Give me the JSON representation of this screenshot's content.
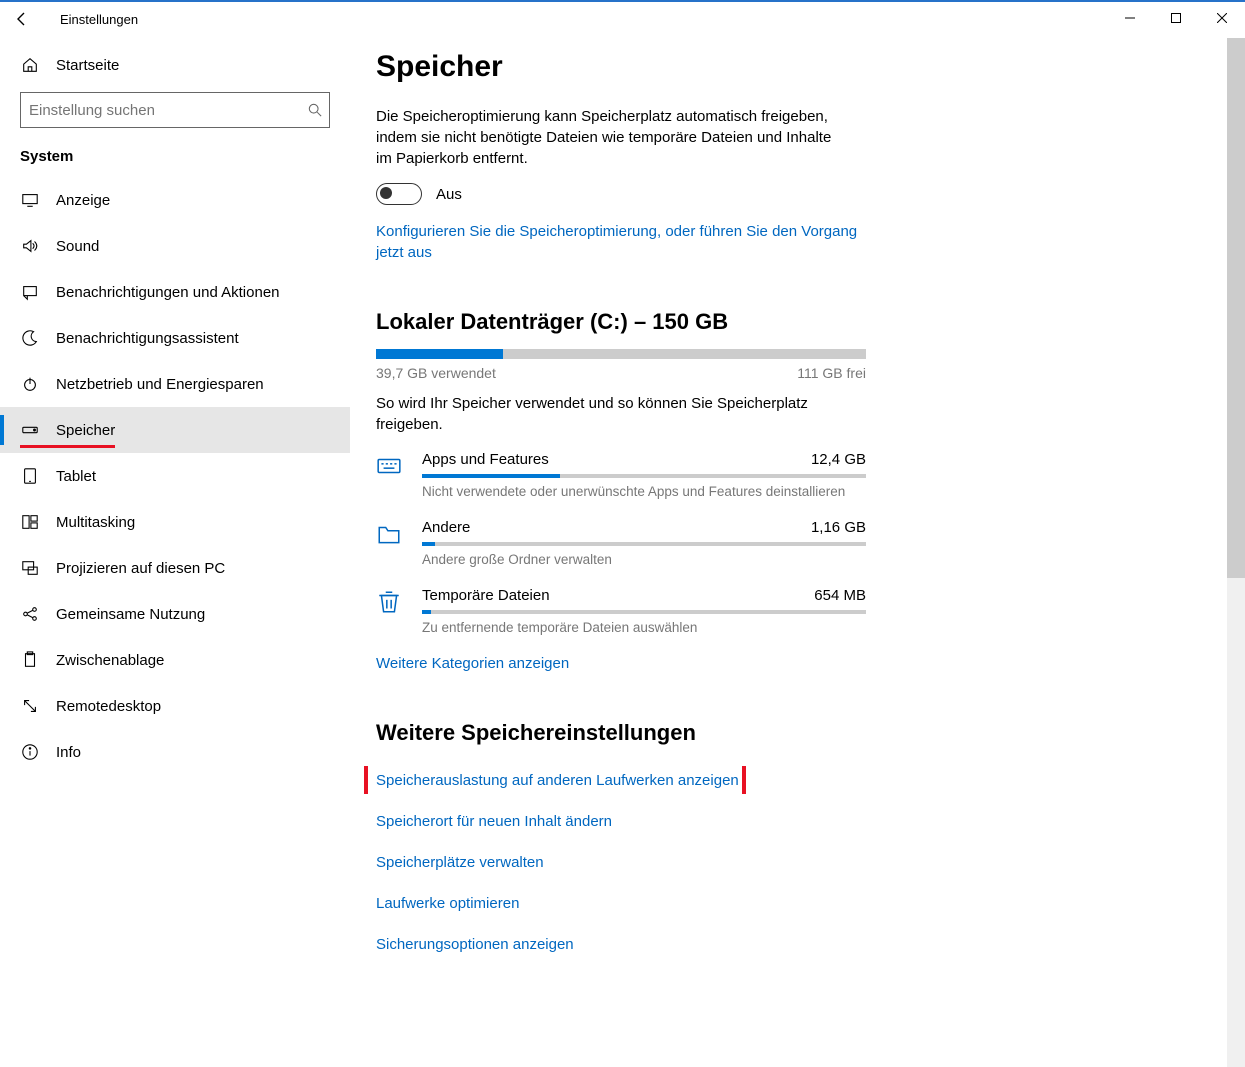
{
  "window": {
    "title": "Einstellungen"
  },
  "sidebar": {
    "home": "Startseite",
    "search_placeholder": "Einstellung suchen",
    "category": "System",
    "items": [
      {
        "label": "Anzeige"
      },
      {
        "label": "Sound"
      },
      {
        "label": "Benachrichtigungen und Aktionen"
      },
      {
        "label": "Benachrichtigungsassistent"
      },
      {
        "label": "Netzbetrieb und Energiesparen"
      },
      {
        "label": "Speicher"
      },
      {
        "label": "Tablet"
      },
      {
        "label": "Multitasking"
      },
      {
        "label": "Projizieren auf diesen PC"
      },
      {
        "label": "Gemeinsame Nutzung"
      },
      {
        "label": "Zwischenablage"
      },
      {
        "label": "Remotedesktop"
      },
      {
        "label": "Info"
      }
    ]
  },
  "main": {
    "title": "Speicher",
    "intro": "Die Speicheroptimierung kann Speicherplatz automatisch freigeben, indem sie nicht benötigte Dateien wie temporäre Dateien und Inhalte im Papierkorb entfernt.",
    "toggle_label": "Aus",
    "configure_link": "Konfigurieren Sie die Speicheroptimierung, oder führen Sie den Vorgang jetzt aus",
    "disk_title": "Lokaler Datenträger (C:) – 150 GB",
    "disk_used_label": "39,7 GB verwendet",
    "disk_free_label": "111 GB frei",
    "disk_fill_percent": 26,
    "usage_intro": "So wird Ihr Speicher verwendet und so können Sie Speicherplatz freigeben.",
    "usage": [
      {
        "name": "Apps und Features",
        "size": "12,4 GB",
        "percent": 31,
        "sub": "Nicht verwendete oder unerwünschte Apps und Features deinstallieren"
      },
      {
        "name": "Andere",
        "size": "1,16 GB",
        "percent": 3,
        "sub": "Andere große Ordner verwalten"
      },
      {
        "name": "Temporäre Dateien",
        "size": "654 MB",
        "percent": 2,
        "sub": "Zu entfernende temporäre Dateien auswählen"
      }
    ],
    "more_categories": "Weitere Kategorien anzeigen",
    "more_settings_title": "Weitere Speichereinstellungen",
    "more_links": [
      "Speicherauslastung auf anderen Laufwerken anzeigen",
      "Speicherort für neuen Inhalt ändern",
      "Speicherplätze verwalten",
      "Laufwerke optimieren",
      "Sicherungsoptionen anzeigen"
    ]
  }
}
